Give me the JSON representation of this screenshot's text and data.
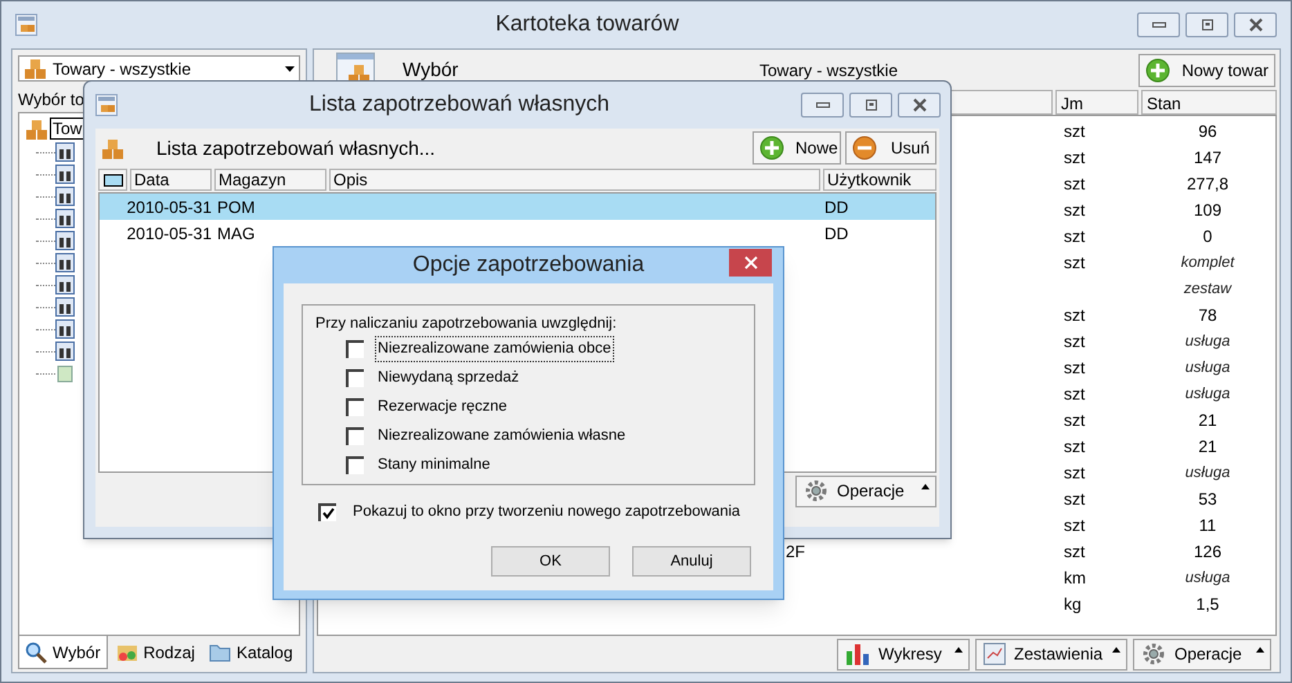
{
  "main_window": {
    "title": "Kartoteka towarów",
    "left_panel": {
      "filter": "Towary - wszystkie",
      "label": "Wybór to",
      "tree_root": "Tow",
      "tabs": [
        {
          "label": "Wybór",
          "selected": true
        },
        {
          "label": "Rodzaj",
          "selected": false
        },
        {
          "label": "Katalog",
          "selected": false
        }
      ]
    },
    "header": {
      "title": "Wybór",
      "subtitle": "Towary - wszystkie",
      "new_button": "Nowy towar"
    },
    "table": {
      "columns": [
        "Jm",
        "Stan"
      ],
      "rows": [
        {
          "jm": "szt",
          "stan": "96",
          "kind": "number"
        },
        {
          "jm": "szt",
          "stan": "147",
          "kind": "number"
        },
        {
          "jm": "szt",
          "stan": "277,8",
          "kind": "number"
        },
        {
          "jm": "szt",
          "stan": "109",
          "kind": "number"
        },
        {
          "jm": "szt",
          "stan": "0",
          "kind": "number"
        },
        {
          "jm": "szt",
          "stan": "komplet",
          "kind": "label"
        },
        {
          "stan": "zestaw",
          "kind": "label"
        },
        {
          "jm": "szt",
          "stan": "78",
          "kind": "number"
        },
        {
          "jm": "szt",
          "stan": "usługa",
          "kind": "label"
        },
        {
          "jm": "szt",
          "stan": "usługa",
          "kind": "label"
        },
        {
          "jm": "szt",
          "stan": "usługa",
          "kind": "label"
        },
        {
          "jm": "szt",
          "stan": "21",
          "kind": "number"
        },
        {
          "jm": "szt",
          "stan": "21",
          "kind": "number"
        },
        {
          "jm": "szt",
          "stan": "usługa",
          "kind": "label"
        },
        {
          "jm": "szt",
          "stan": "53",
          "kind": "number"
        },
        {
          "jm": "szt",
          "stan": "11",
          "kind": "number"
        },
        {
          "column_1": "2F",
          "jm": "szt",
          "stan": "126",
          "kind": "number"
        },
        {
          "jm": "km",
          "stan": "usługa",
          "kind": "label"
        },
        {
          "jm": "kg",
          "stan": "1,5",
          "kind": "number"
        }
      ]
    },
    "bottom_buttons": [
      "Wykresy",
      "Zestawienia",
      "Operacje"
    ]
  },
  "list_window": {
    "title": "Lista zapotrzebowań własnych",
    "heading": "Lista zapotrzebowań własnych...",
    "buttons": [
      "Nowe",
      "Usuń"
    ],
    "columns": [
      "Data",
      "Magazyn",
      "Opis",
      "Użytkownik"
    ],
    "rows": [
      {
        "data": "2010-05-31",
        "magazyn": "POM",
        "uzytkownik": "DD",
        "selected": true
      },
      {
        "data": "2010-05-31",
        "magazyn": "MAG",
        "uzytkownik": "DD",
        "selected": false
      }
    ],
    "operations_button": "Operacje"
  },
  "dialog": {
    "title": "Opcje zapotrzebowania",
    "group_label": "Przy naliczaniu zapotrzebowania uwzględnij:",
    "options": [
      {
        "label": "Niezrealizowane zamówienia obce",
        "checked": false,
        "focused": true
      },
      {
        "label": "Niewydaną sprzedaż",
        "checked": false,
        "focused": false
      },
      {
        "label": "Rezerwacje ręczne",
        "checked": false,
        "focused": false
      },
      {
        "label": "Niezrealizowane zamówienia własne",
        "checked": false,
        "focused": false
      },
      {
        "label": "Stany minimalne",
        "checked": false,
        "focused": false
      }
    ],
    "show_option": {
      "label": "Pokazuj to okno przy tworzeniu nowego zapotrzebowania",
      "checked": true
    },
    "buttons": [
      "OK",
      "Anuluj"
    ]
  }
}
